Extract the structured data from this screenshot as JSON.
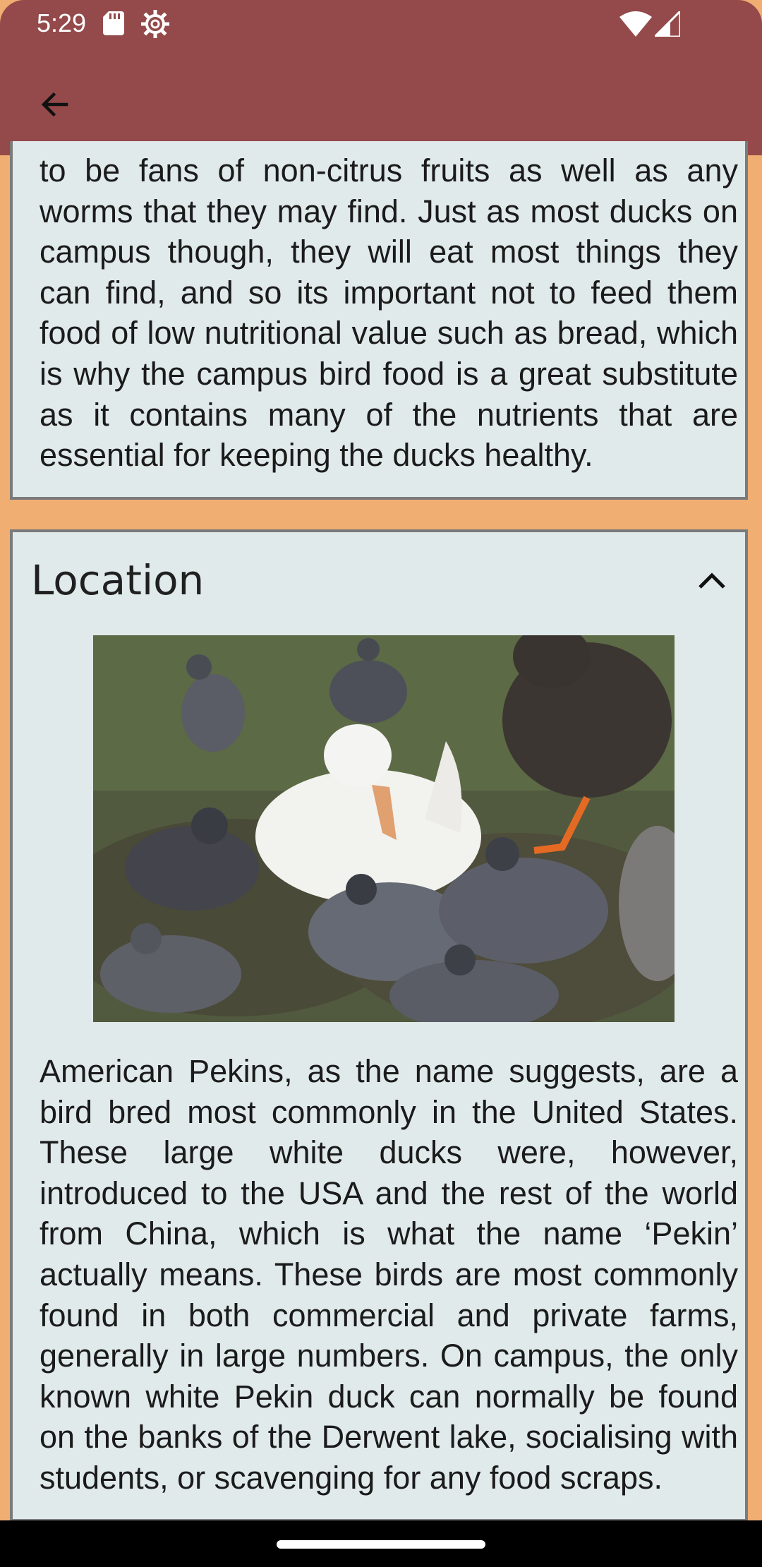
{
  "status_bar": {
    "time": "5:29",
    "icons": [
      "sd-card-icon",
      "settings-gear-icon",
      "wifi-icon",
      "cell-signal-icon"
    ]
  },
  "app_bar": {
    "back_icon": "arrow-back-icon",
    "color": "#944A4A"
  },
  "cards": {
    "previous": {
      "text": "to be fans of non-citrus fruits as well as any worms that they may find. Just as most ducks on campus though, they will eat most things they can find, and so its important not to feed them food of low nutritional value such as bread, which is why the campus bird food is a great substitute as it contains many of the nutrients that are essential for keeping the ducks healthy."
    },
    "location": {
      "title": "Location",
      "collapse_icon": "chevron-up-icon",
      "image_icon": "duck-photo",
      "text": "American Pekins, as the name suggests, are a bird bred most commonly in the United States. These large white ducks were, however, introduced to the USA and the rest of the world from China, which is what the name ‘Pekin’ actually means. These birds are most commonly found in both commercial and private farms, generally in large numbers. On campus, the only known white Pekin duck can normally be found on the banks of the Derwent lake, socialising with students, or scavenging for any food scraps."
    }
  },
  "colors": {
    "background": "#F0AE72",
    "card": "#E1EAEA",
    "card_border": "#7B7B7B"
  }
}
